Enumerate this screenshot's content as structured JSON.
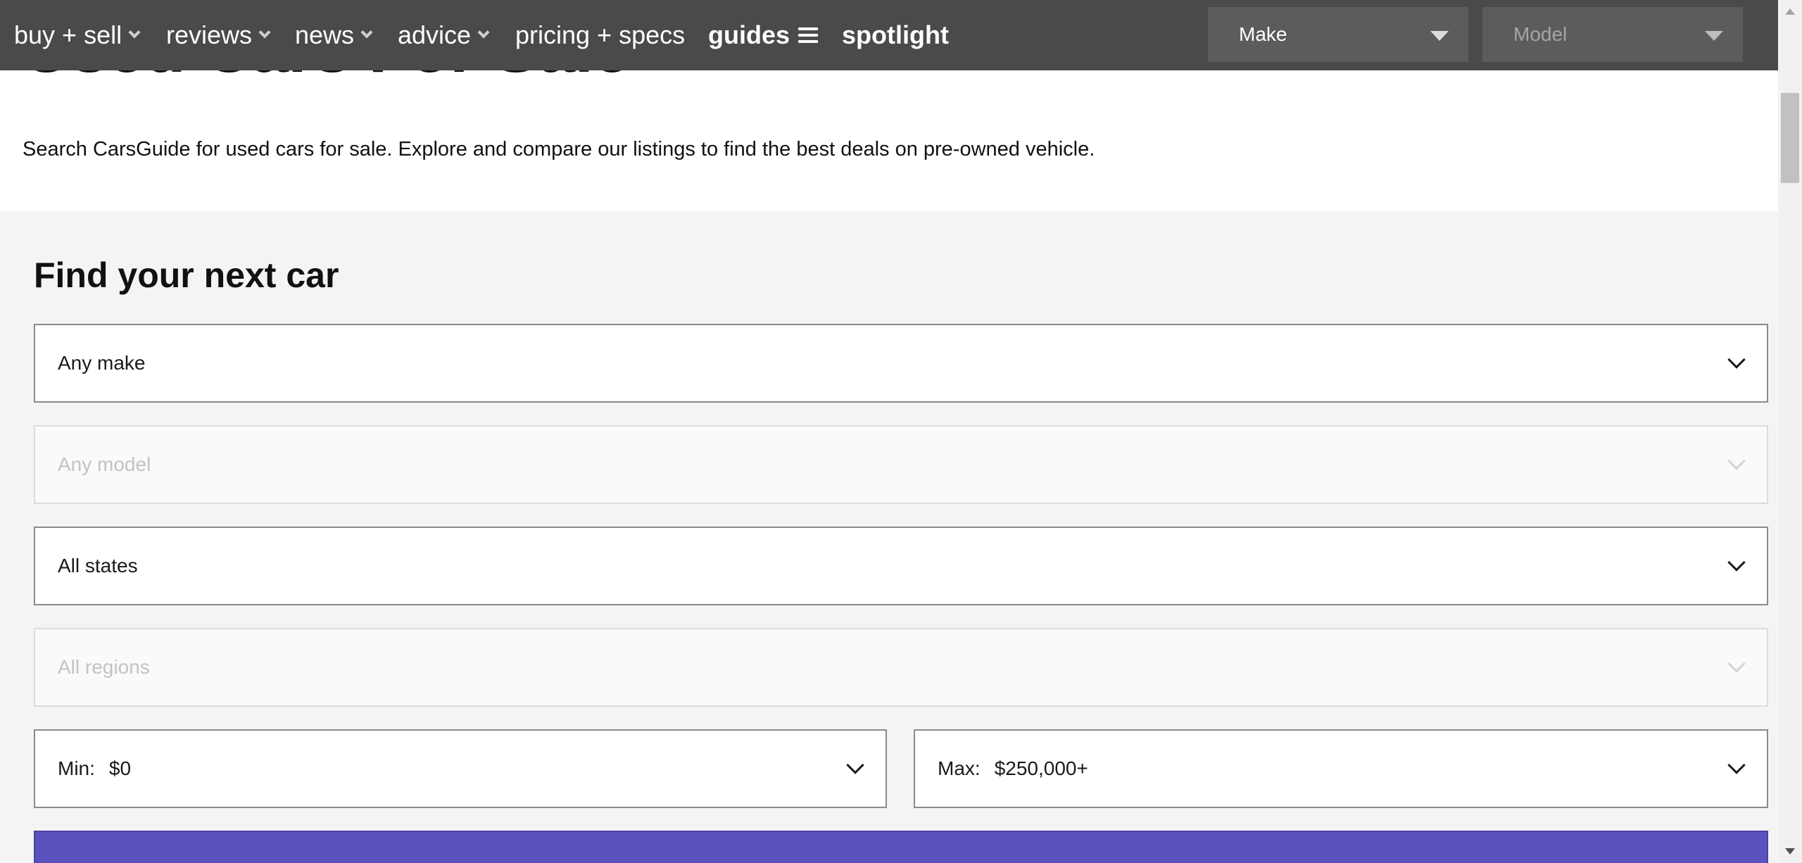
{
  "page": {
    "title": "Used Cars For Sale",
    "intro": "Search CarsGuide for used cars for sale. Explore and compare our listings to find the best deals on pre-owned vehicle."
  },
  "nav": {
    "items": [
      {
        "label": "buy + sell"
      },
      {
        "label": "reviews"
      },
      {
        "label": "news"
      },
      {
        "label": "advice"
      },
      {
        "label": "pricing + specs"
      },
      {
        "label": "guides"
      },
      {
        "label": "spotlight"
      }
    ],
    "make_select": "Make",
    "model_select": "Model"
  },
  "search": {
    "heading": "Find your next car",
    "make": "Any make",
    "model": "Any model",
    "state": "All states",
    "region": "All regions",
    "min_label": "Min:",
    "min_value": "$0",
    "max_label": "Max:",
    "max_value": "$250,000+"
  },
  "colors": {
    "nav_bg": "#4a4a4a",
    "section_bg": "#f4f4f4",
    "button_purple": "#5c52bd"
  }
}
